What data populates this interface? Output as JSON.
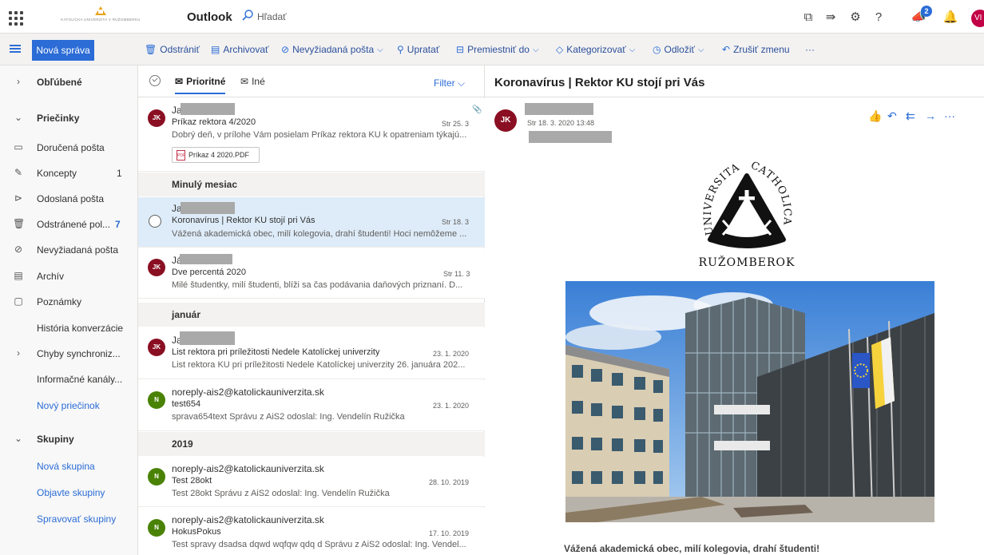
{
  "topbar": {
    "org_logo_text": "KATOLÍCKA UNIVERZITA V RUŽOMBERKU",
    "app_name": "Outlook",
    "search_placeholder": "Hľadať",
    "notification_count": "2",
    "user_initials": "VI"
  },
  "commands": {
    "new_message": "Nová správa",
    "delete": "Odstrániť",
    "archive": "Archivovať",
    "junk": "Nevyžiadaná pošta",
    "sweep": "Upratať",
    "move_to": "Premiestniť do",
    "categorize": "Kategorizovať",
    "snooze": "Odložiť",
    "undo": "Zrušiť zmenu",
    "more": "···"
  },
  "nav": {
    "favorites": "Obľúbené",
    "folders": "Priečinky",
    "inbox": "Doručená pošta",
    "drafts": "Koncepty",
    "drafts_count": "1",
    "sent": "Odoslaná pošta",
    "deleted": "Odstránené pol...",
    "deleted_count": "7",
    "junk": "Nevyžiadaná pošta",
    "archive": "Archív",
    "notes": "Poznámky",
    "conversation_history": "História konverzácie",
    "sync_errors": "Chyby synchroniz...",
    "rss": "Informačné kanály...",
    "new_folder": "Nový priečinok",
    "groups": "Skupiny",
    "new_group": "Nová skupina",
    "discover_groups": "Objavte skupiny",
    "manage_groups": "Spravovať skupiny"
  },
  "list": {
    "tab_focused": "Prioritné",
    "tab_other": "Iné",
    "filter": "Filter",
    "groups": {
      "last_month": "Minulý mesiac",
      "january": "január",
      "year2019": "2019"
    },
    "messages": [
      {
        "initials": "JK",
        "from": "Ja",
        "subject": "Príkaz rektora 4/2020",
        "date": "Str 25. 3",
        "preview": "Dobrý deň, v prílohe Vám posielam Príkaz rektora KU k opatreniam týkajú...",
        "attachment": "Príkaz 4 2020.PDF"
      },
      {
        "initials": "",
        "from": "Ja",
        "subject": "Koronavírus | Rektor KU stojí pri Vás",
        "date": "Str 18. 3",
        "preview": "Vážená akademická obec, milí kolegovia, drahí študenti! Hoci nemôžeme ..."
      },
      {
        "initials": "JK",
        "from": "Já",
        "subject": "Dve percentá 2020",
        "date": "Str 11. 3",
        "preview": "Milé študentky, milí študenti, blíži sa čas podávania daňových priznaní. D..."
      },
      {
        "initials": "JK",
        "from": "Ja",
        "subject": "List rektora pri príležitosti Nedele Katolíckej univerzity",
        "date": "23. 1. 2020",
        "preview": "List rektora KU pri príležitosti Nedele Katolíckej univerzity 26. januára 202..."
      },
      {
        "initials": "N",
        "from": "noreply-ais2@katolickauniverzita.sk",
        "subject": "test654",
        "date": "23. 1. 2020",
        "preview": "sprava654text Správu z AiS2 odoslal: Ing. Vendelín Ružička"
      },
      {
        "initials": "N",
        "from": "noreply-ais2@katolickauniverzita.sk",
        "subject": "Test 28okt",
        "date": "28. 10. 2019",
        "preview": "Test 28okt Správu z AiS2 odoslal: Ing. Vendelín Ružička"
      },
      {
        "initials": "N",
        "from": "noreply-ais2@katolickauniverzita.sk",
        "subject": "HokusPokus",
        "date": "17. 10. 2019",
        "preview": "Test spravy dsadsa dqwd wqfqw qdq d Správu z AiS2 odoslal: Ing. Vendel..."
      }
    ]
  },
  "reading": {
    "title": "Koronavírus | Rektor KU stojí pri Vás",
    "sender_initials": "JK",
    "date": "Str 18. 3. 2020 13:48",
    "more": "···",
    "emblem_text_left": "UNIVERSITAS",
    "emblem_text_right": "CATHOLICA",
    "emblem_text_bottom": "RUŽOMBEROK",
    "greeting": "Vážená akademická obec, milí kolegovia, drahí študenti!"
  },
  "colors": {
    "accent": "#2b6cd6",
    "sender_avatar": "#8a0f22",
    "ais_avatar": "#498205",
    "selected_row": "#deecf9"
  }
}
